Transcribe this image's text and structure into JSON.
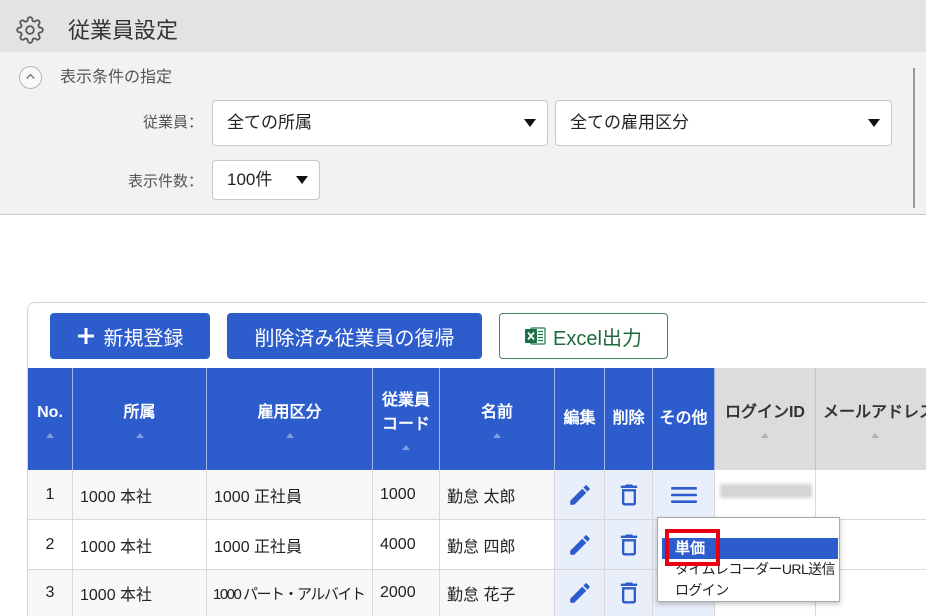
{
  "header": {
    "title": "従業員設定",
    "icon": "gear-icon"
  },
  "filter": {
    "toggle_icon": "chevron-up-icon",
    "toggle_label": "表示条件の指定",
    "employee_label": "従業員：",
    "department_value": "全ての所属",
    "employment_type_value": "全ての雇用区分",
    "count_label": "表示件数：",
    "count_value": "100件"
  },
  "toolbar": {
    "new_icon": "plus-icon",
    "new_label": "新規登録",
    "restore_label": "削除済み従業員の復帰",
    "excel_icon": "excel-icon",
    "excel_label": "Excel出力"
  },
  "table": {
    "columns": [
      {
        "label": "No.",
        "sortable": true
      },
      {
        "label": "所属",
        "sortable": true
      },
      {
        "label": "雇用区分",
        "sortable": true
      },
      {
        "label": "従業員コード",
        "sortable": true
      },
      {
        "label": "名前",
        "sortable": true
      },
      {
        "label": "編集",
        "sortable": false
      },
      {
        "label": "削除",
        "sortable": false
      },
      {
        "label": "その他",
        "sortable": false
      },
      {
        "label": "ログインID",
        "sortable": true
      },
      {
        "label": "メールアドレス",
        "sortable": true
      }
    ],
    "row_icons": {
      "edit": "pencil-icon",
      "delete": "trash-icon",
      "other": "menu-icon"
    },
    "rows": [
      {
        "no": "1",
        "department": "1000 本社",
        "employment_type": "1000 正社員",
        "code": "1000",
        "name": "勤怠 太郎"
      },
      {
        "no": "2",
        "department": "1000 本社",
        "employment_type": "1000 正社員",
        "code": "4000",
        "name": "勤怠 四郎"
      },
      {
        "no": "3",
        "department": "1000 本社",
        "employment_type": "1000 パート・アルバイト",
        "code": "2000",
        "name": "勤怠 花子"
      }
    ]
  },
  "context_menu": {
    "items": [
      "単価",
      "タイムレコーダーURL送信",
      "ログイン"
    ],
    "active_index": 0
  },
  "colors": {
    "accent": "#2d5ccd",
    "header_bar": "#e3e3e3",
    "filter_background": "#f2f2f2",
    "gray_column_header": "#dcdcdc",
    "icon_column_background": "#e9effa",
    "excel_green": "#1f6b3b",
    "highlight_red": "#e60012"
  }
}
